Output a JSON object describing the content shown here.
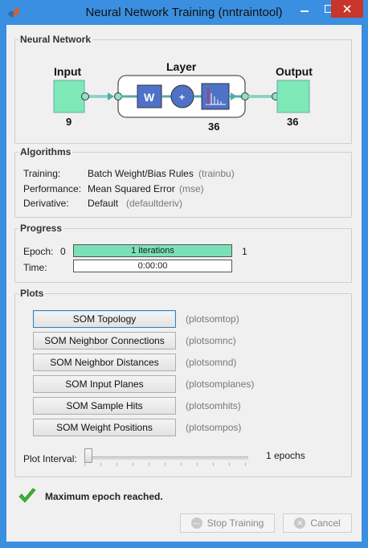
{
  "window": {
    "title": "Neural Network Training (nntraintool)"
  },
  "network": {
    "section_label": "Neural Network",
    "input_label": "Input",
    "input_size": "9",
    "layer_label": "Layer",
    "layer_size": "36",
    "output_label": "Output",
    "output_size": "36",
    "weight_symbol": "W",
    "sum_symbol": "+"
  },
  "algorithms": {
    "section_label": "Algorithms",
    "rows": [
      {
        "key": "Training:",
        "value": "Batch Weight/Bias Rules",
        "code": "(trainbu)"
      },
      {
        "key": "Performance:",
        "value": "Mean Squared Error",
        "code": "(mse)"
      },
      {
        "key": "Derivative:",
        "value": "Default",
        "code": "(defaultderiv)"
      }
    ]
  },
  "progress": {
    "section_label": "Progress",
    "epoch_label": "Epoch:",
    "epoch_start": "0",
    "epoch_bar_text": "1 iterations",
    "epoch_end": "1",
    "epoch_fraction": 1.0,
    "time_label": "Time:",
    "time_value": "0:00:00"
  },
  "plots": {
    "section_label": "Plots",
    "buttons": [
      {
        "label": "SOM Topology",
        "code": "(plotsomtop)"
      },
      {
        "label": "SOM Neighbor Connections",
        "code": "(plotsomnc)"
      },
      {
        "label": "SOM Neighbor Distances",
        "code": "(plotsomnd)"
      },
      {
        "label": "SOM Input Planes",
        "code": "(plotsomplanes)"
      },
      {
        "label": "SOM Sample Hits",
        "code": "(plotsomhits)"
      },
      {
        "label": "SOM Weight Positions",
        "code": "(plotsompos)"
      }
    ],
    "interval_label": "Plot Interval:",
    "interval_value": "1 epochs",
    "interval_fraction": 0.0
  },
  "status": {
    "message": "Maximum epoch reached."
  },
  "actions": {
    "stop_label": "Stop Training",
    "cancel_label": "Cancel"
  },
  "colors": {
    "titlebar": "#3a8fe0",
    "progress_fill": "#7be0b7",
    "io_box": "#7ee8b6",
    "close": "#c7352b"
  }
}
